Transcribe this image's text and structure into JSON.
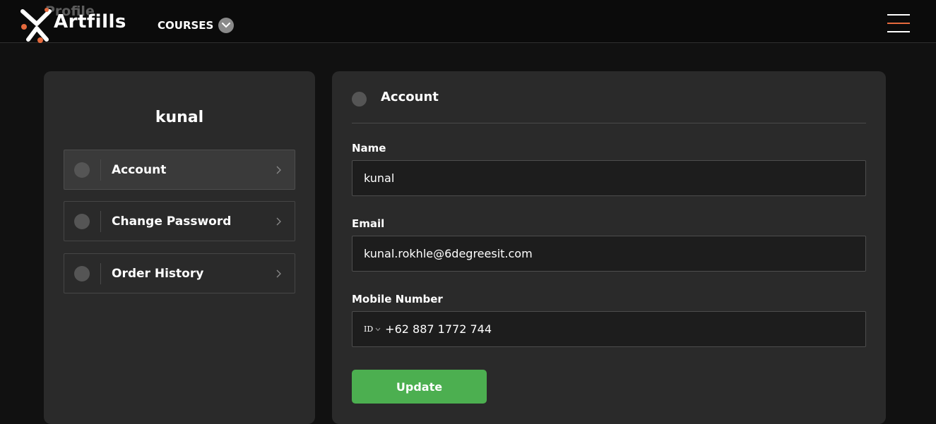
{
  "header": {
    "ghost_title": "Profile",
    "brand": "Artfills",
    "courses_label": "COURSES",
    "accent_color": "#e56a3d"
  },
  "sidebar": {
    "username": "kunal",
    "items": [
      {
        "label": "Account",
        "active": true
      },
      {
        "label": "Change Password",
        "active": false
      },
      {
        "label": "Order History",
        "active": false
      }
    ]
  },
  "main": {
    "section_title": "Account",
    "fields": {
      "name": {
        "label": "Name",
        "value": "kunal"
      },
      "email": {
        "label": "Email",
        "value": "kunal.rokhle@6degreesit.com"
      },
      "mobile": {
        "label": "Mobile Number",
        "country_code": "ID",
        "value": "+62 887 1772 744"
      }
    },
    "update_label": "Update",
    "button_color": "#4caf50"
  }
}
